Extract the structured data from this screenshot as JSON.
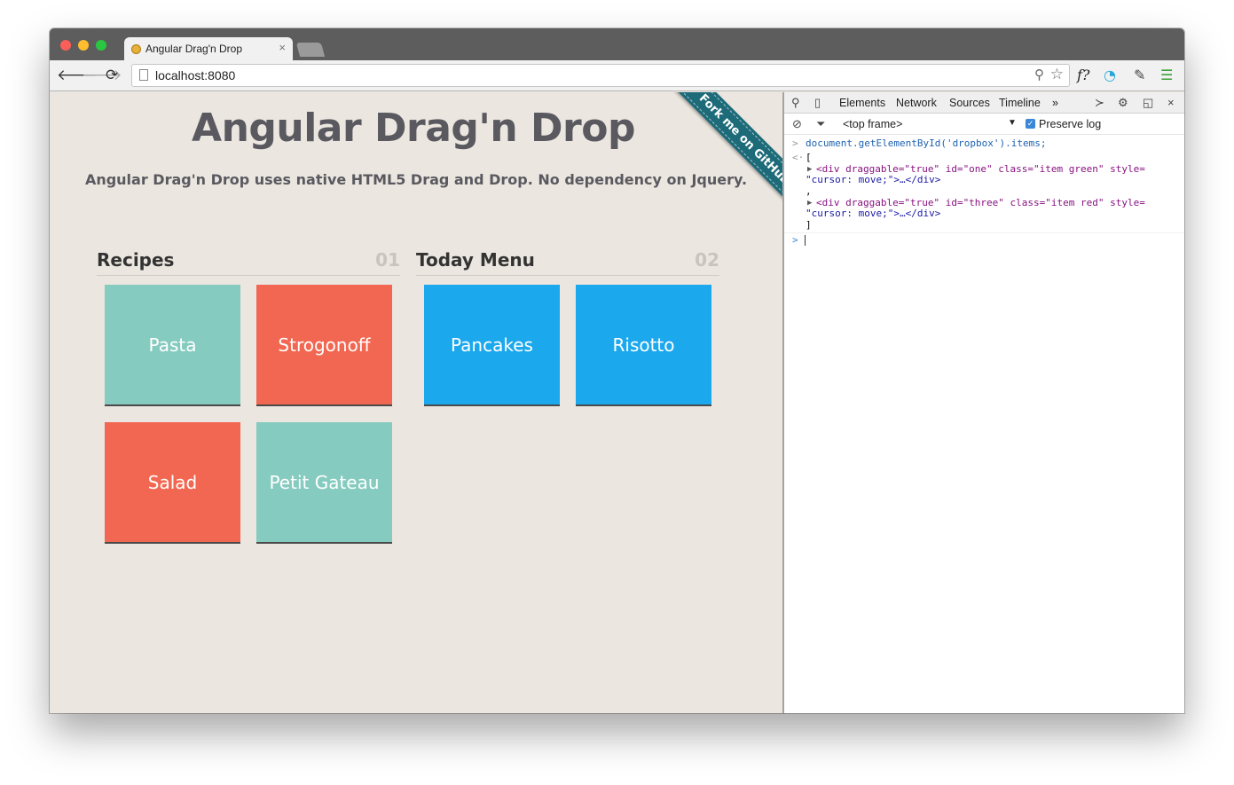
{
  "browser": {
    "tab_title": "Angular Drag'n Drop",
    "tab_close": "×",
    "url": "localhost:8080",
    "icons": {
      "back": "arrow-left-icon",
      "forward": "arrow-right-icon",
      "reload": "reload-icon",
      "zoom": "magnifier-icon",
      "star": "star-icon",
      "ext_font": "f?",
      "ext_wifi": "signal-icon",
      "ext_eyedropper": "eyedropper-icon",
      "ext_menu": "hamburger-icon"
    }
  },
  "page": {
    "title": "Angular Drag'n Drop",
    "subtitle": "Angular Drag'n Drop uses native HTML5 Drag and Drop. No dependency on Jquery.",
    "ribbon": "Fork me on GitHub",
    "columns": [
      {
        "title": "Recipes",
        "number": "01",
        "items": [
          {
            "label": "Pasta",
            "color": "green"
          },
          {
            "label": "Strogonoff",
            "color": "red"
          },
          {
            "label": "Salad",
            "color": "red"
          },
          {
            "label": "Petit Gateau",
            "color": "green"
          }
        ]
      },
      {
        "title": "Today Menu",
        "number": "02",
        "items": [
          {
            "label": "Pancakes",
            "color": "blue"
          },
          {
            "label": "Risotto",
            "color": "blue"
          }
        ]
      }
    ],
    "colors": {
      "green": "#86cbbf",
      "red": "#f26751",
      "blue": "#1ba8ed",
      "background": "#ebe6df"
    }
  },
  "devtools": {
    "tabs": [
      "Elements",
      "Network",
      "Sources",
      "Timeline"
    ],
    "more": "»",
    "frame": "<top frame>",
    "preserve_log": "Preserve log",
    "console": {
      "command": "document.getElementById('dropbox').items;",
      "open_bracket": "[",
      "item1_line1": "<div draggable=\"true\" id=\"one\" class=\"item green\" style=",
      "item1_line2": "\"cursor: move;\">…</div>",
      "comma": ",",
      "item2_line1": "<div draggable=\"true\" id=\"three\" class=\"item red\" style=",
      "item2_line2": "\"cursor: move;\">…</div>",
      "close_bracket": "]"
    }
  }
}
